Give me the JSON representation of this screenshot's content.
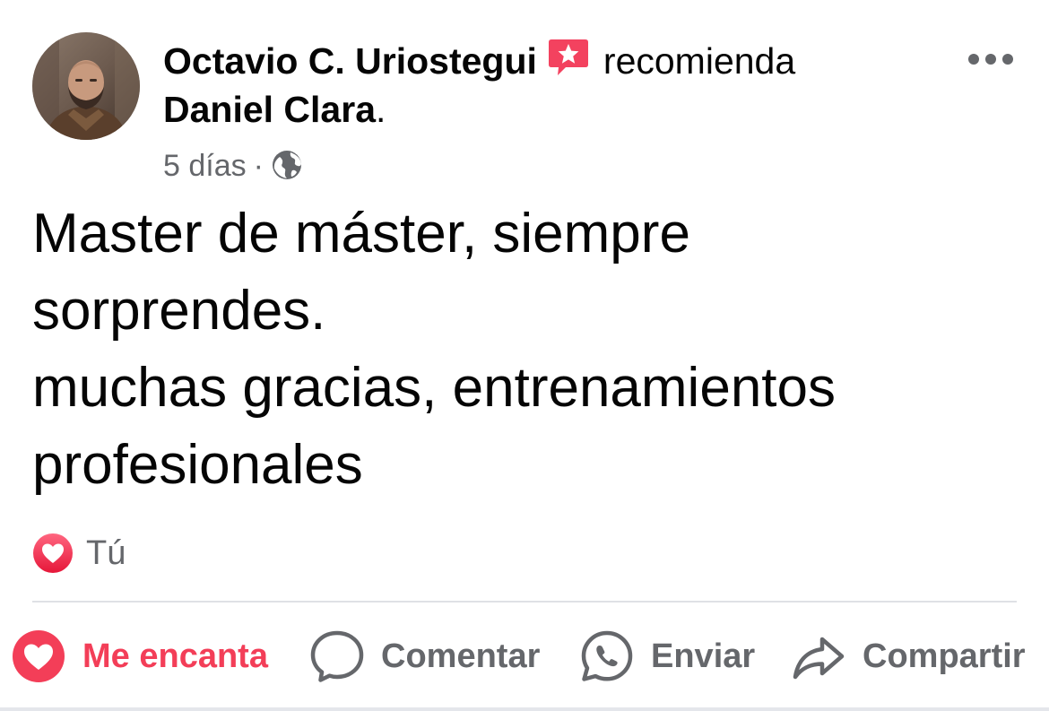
{
  "post": {
    "author": "Octavio C. Uriostegui",
    "verb": "recomienda",
    "recipient": "Daniel Clara",
    "recipient_suffix": ".",
    "time": "5 días",
    "separator": "·",
    "privacy_icon": "globe-icon",
    "recommend_badge_icon": "recommend-star-icon",
    "body": [
      "Master de máster, siempre",
      "sorprendes.",
      "muchas gracias, entrenamientos",
      "profesionales"
    ]
  },
  "reactions": {
    "icon": "heart-reaction-icon",
    "names": "Tú"
  },
  "actions": {
    "love_label": "Me encanta",
    "comment_label": "Comentar",
    "send_label": "Enviar",
    "share_label": "Compartir"
  },
  "colors": {
    "love_red": "#f33e58",
    "secondary_text": "#65676b",
    "recommend_badge": "#f3425f"
  }
}
